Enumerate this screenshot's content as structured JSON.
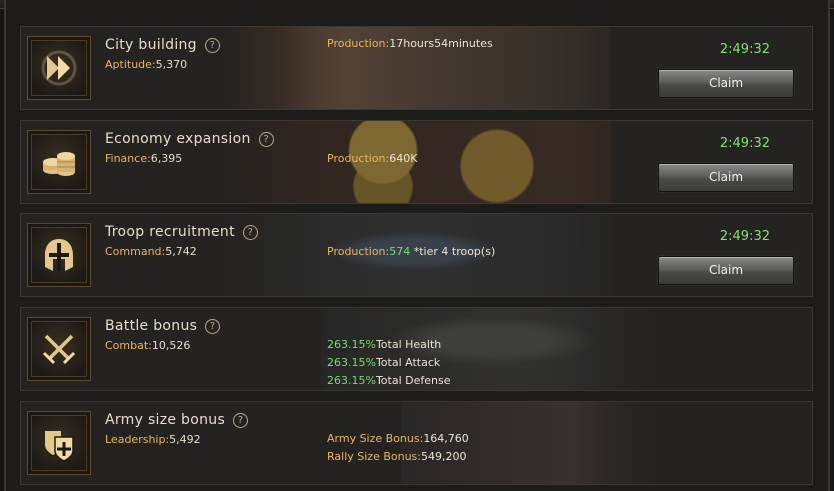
{
  "rows": [
    {
      "title": "City building",
      "stat_label": "Aptitude:",
      "stat_value": "5,370",
      "icon": "fast-forward-icon",
      "prod_label": "Production:",
      "prod_value": "17hours54minutes",
      "timer": "2:49:32",
      "claim_label": "Claim"
    },
    {
      "title": "Economy expansion",
      "stat_label": "Finance:",
      "stat_value": "6,395",
      "icon": "coins-icon",
      "prod_label": "Production:",
      "prod_value": "640K",
      "timer": "2:49:32",
      "claim_label": "Claim"
    },
    {
      "title": "Troop recruitment",
      "stat_label": "Command:",
      "stat_value": "5,742",
      "icon": "helmet-icon",
      "prod_label": "Production:",
      "prod_value": "574",
      "prod_suffix": " *tier 4 troop(s)",
      "timer": "2:49:32",
      "claim_label": "Claim"
    },
    {
      "title": "Battle bonus",
      "stat_label": "Combat:",
      "stat_value": "10,526",
      "icon": "crossed-swords-icon",
      "bonuses": [
        {
          "value": "263.15%",
          "label": "Total Health"
        },
        {
          "value": "263.15%",
          "label": "Total Attack"
        },
        {
          "value": "263.15%",
          "label": "Total Defense"
        }
      ]
    },
    {
      "title": "Army size bonus",
      "stat_label": "Leadership:",
      "stat_value": "5,492",
      "icon": "shield-plus-icon",
      "army_label": "Army Size Bonus:",
      "army_value": "164,760",
      "rally_label": "Rally Size Bonus:",
      "rally_value": "549,200"
    }
  ],
  "help_glyph": "?",
  "colors": {
    "accent_gold": "#e9b65a",
    "timer_green": "#7ee46b",
    "bonus_green": "#6fe06a"
  }
}
